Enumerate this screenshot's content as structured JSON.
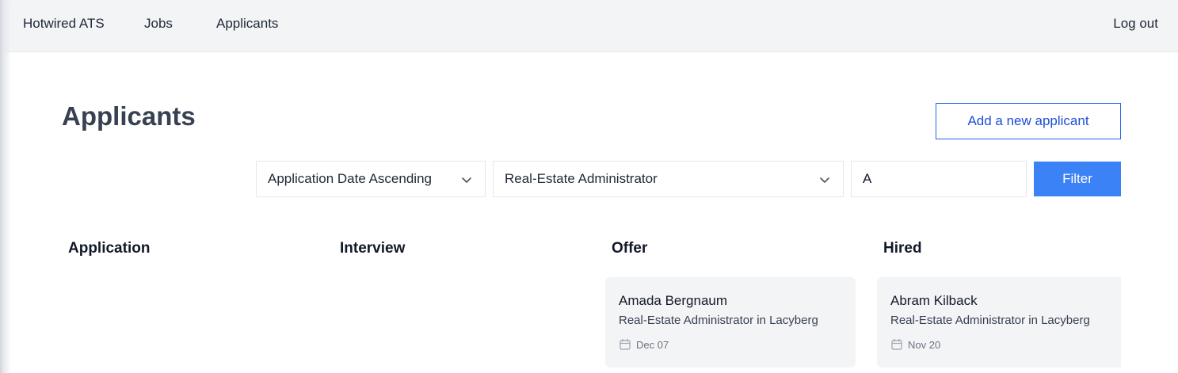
{
  "navbar": {
    "brand": "Hotwired ATS",
    "links": [
      "Jobs",
      "Applicants"
    ],
    "logout": "Log out"
  },
  "page": {
    "title": "Applicants",
    "add_button": "Add a new applicant"
  },
  "filters": {
    "sort_selected": "Application Date Ascending",
    "job_selected": "Real-Estate Administrator",
    "search_value": "A",
    "filter_button": "Filter"
  },
  "columns": [
    {
      "title": "Application",
      "cards": []
    },
    {
      "title": "Interview",
      "cards": []
    },
    {
      "title": "Offer",
      "cards": [
        {
          "name": "Amada Bergnaum",
          "role": "Real-Estate Administrator in Lacyberg",
          "date": "Dec 07"
        }
      ]
    },
    {
      "title": "Hired",
      "cards": [
        {
          "name": "Abram Kilback",
          "role": "Real-Estate Administrator in Lacyberg",
          "date": "Nov 20"
        }
      ]
    }
  ],
  "icons": {
    "dropdown": "chevron-down-icon",
    "date": "calendar-icon"
  },
  "colors": {
    "primary": "#3b82f6",
    "primary_text": "#1d4ed8",
    "navbar_bg": "#f3f4f6",
    "card_bg": "#f3f4f6",
    "title": "#374151"
  }
}
